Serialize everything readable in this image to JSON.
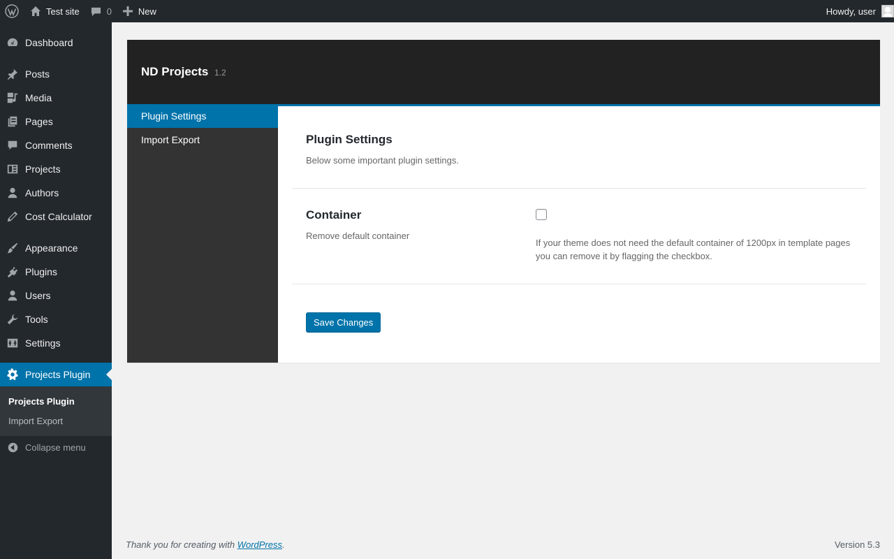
{
  "adminbar": {
    "site_name": "Test site",
    "comments_count": "0",
    "new_label": "New",
    "greeting": "Howdy, user"
  },
  "sidebar": {
    "items": [
      {
        "label": "Dashboard",
        "icon": "dashboard-icon"
      },
      {
        "label": "Posts",
        "icon": "pin-icon"
      },
      {
        "label": "Media",
        "icon": "media-icon"
      },
      {
        "label": "Pages",
        "icon": "pages-icon"
      },
      {
        "label": "Comments",
        "icon": "comment-icon"
      },
      {
        "label": "Projects",
        "icon": "portfolio-icon"
      },
      {
        "label": "Authors",
        "icon": "user-icon"
      },
      {
        "label": "Cost Calculator",
        "icon": "pencil-icon"
      },
      {
        "label": "Appearance",
        "icon": "brush-icon"
      },
      {
        "label": "Plugins",
        "icon": "plug-icon"
      },
      {
        "label": "Users",
        "icon": "users-icon"
      },
      {
        "label": "Tools",
        "icon": "wrench-icon"
      },
      {
        "label": "Settings",
        "icon": "settings-icon"
      },
      {
        "label": "Projects Plugin",
        "icon": "gear-icon"
      }
    ],
    "submenu": [
      "Projects Plugin",
      "Import Export"
    ],
    "collapse_label": "Collapse menu"
  },
  "plugin": {
    "title": "ND Projects",
    "version": "1.2",
    "nav": [
      "Plugin Settings",
      "Import Export"
    ],
    "section_title": "Plugin Settings",
    "section_desc": "Below some important plugin settings.",
    "option_title": "Container",
    "option_desc": "Remove default container",
    "option_help": "If your theme does not need the default container of 1200px in template pages you can remove it by flagging the checkbox.",
    "save_label": "Save Changes"
  },
  "footer": {
    "thanks_prefix": "Thank you for creating with ",
    "thanks_link": "WordPress",
    "thanks_suffix": ".",
    "version": "Version 5.3"
  },
  "colors": {
    "accent": "#0073aa",
    "adminbar_bg": "#23282d",
    "panel_header_bg": "#222222",
    "panel_nav_bg": "#333333"
  }
}
